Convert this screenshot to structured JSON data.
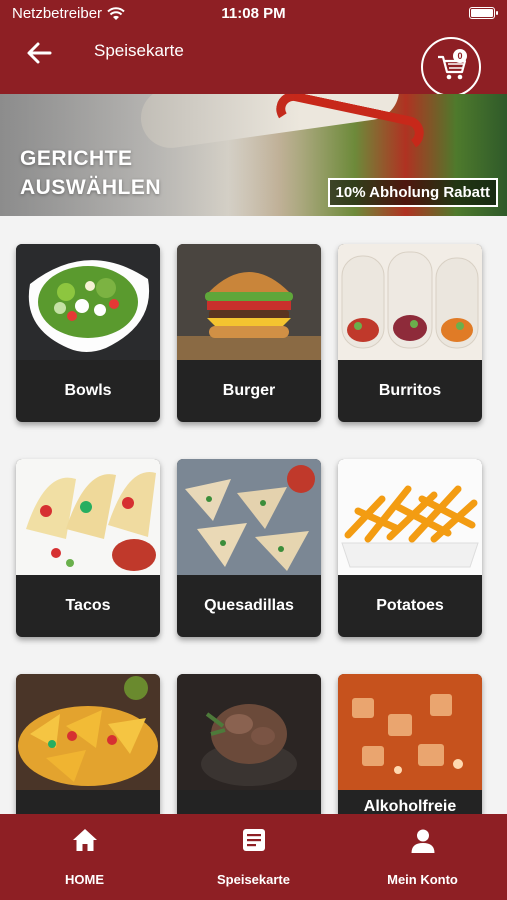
{
  "status_bar": {
    "carrier": "Netzbetreiber",
    "time": "11:08 PM"
  },
  "header": {
    "title": "Speisekarte",
    "cart_count": "0"
  },
  "banner": {
    "line1": "GERICHTE",
    "line2": "AUSWÄHLEN",
    "badge": "10% Abholung Rabatt"
  },
  "categories": [
    {
      "label": "Bowls"
    },
    {
      "label": "Burger"
    },
    {
      "label": "Burritos"
    },
    {
      "label": "Tacos"
    },
    {
      "label": "Quesadillas"
    },
    {
      "label": "Potatoes"
    },
    {
      "label": ""
    },
    {
      "label": ""
    },
    {
      "label": "Alkoholfreie"
    }
  ],
  "bottom_nav": [
    {
      "label": "HOME",
      "icon": "home-icon"
    },
    {
      "label": "Speisekarte",
      "icon": "menu-list-icon"
    },
    {
      "label": "Mein Konto",
      "icon": "person-icon"
    }
  ],
  "colors": {
    "brand": "#8e1f24",
    "card": "#232323",
    "background": "#f3f3f3"
  }
}
